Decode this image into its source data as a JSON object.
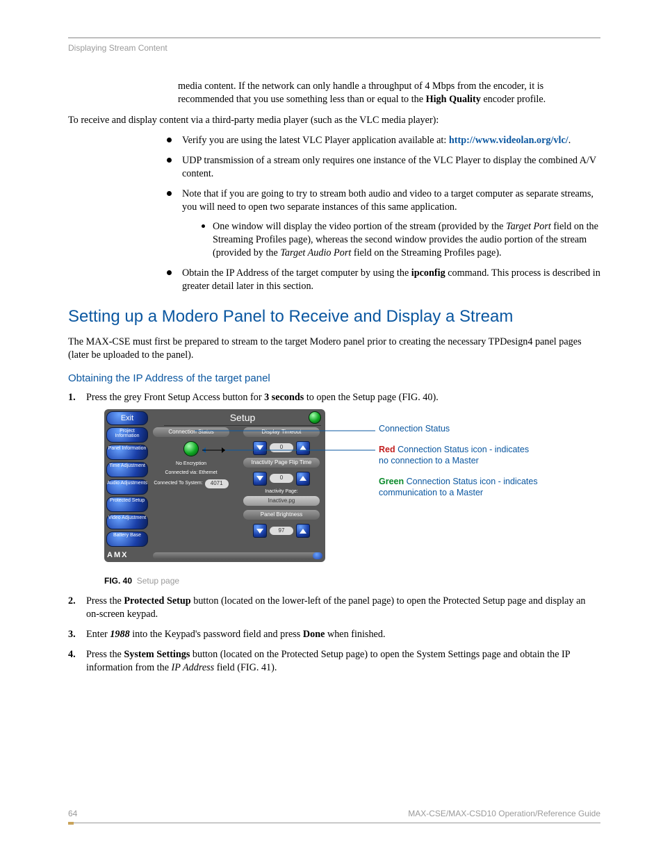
{
  "running_head": "Displaying Stream Content",
  "intro_para": {
    "pre": "media content. If the network can only handle a throughput of 4 Mbps from the encoder, it is recommended that you use something less than or equal to the ",
    "bold": "High Quality",
    "post": " encoder profile."
  },
  "lead_para": "To receive and display content via a third-party media player (such as the VLC media player):",
  "bullets": [
    {
      "pre": "Verify you are using the latest VLC Player application available at: ",
      "link": "http://www.videolan.org/vlc/",
      "post": "."
    },
    {
      "text": "UDP transmission of a stream only requires one instance of the VLC Player to display the combined A/V content."
    },
    {
      "text": "Note that if you are going to try to stream both audio and video to a target computer as separate streams, you will need to open two separate instances of this same application.",
      "sub": {
        "pre": "One window will display the video portion of the stream (provided by the ",
        "i1": "Target Port",
        "mid": " field on the Streaming Profiles page), whereas the second window provides the audio portion of the stream (provided by the ",
        "i2": "Target Audio Port",
        "post": " field on the Streaming Profiles page)."
      }
    },
    {
      "pre4": "Obtain the IP Address of the target computer by using the ",
      "b4": "ipconfig",
      "post4": " command. This process is described in greater detail later in this section."
    }
  ],
  "h1": "Setting up a Modero Panel to Receive and Display a Stream",
  "h1_para": "The MAX-CSE must first be prepared to stream to the target Modero panel prior to creating the necessary TPDesign4 panel pages (later be uploaded to the panel).",
  "h2": "Obtaining the IP Address of the target panel",
  "steps": {
    "s1": {
      "pre": "Press the grey Front Setup Access button for ",
      "b": "3 seconds",
      "post": " to open the Setup page (FIG. 40)."
    },
    "s2": {
      "pre": "Press the ",
      "b": "Protected Setup",
      "post": " button (located on the lower-left of the panel page) to open the Protected Setup page and display an on-screen keypad."
    },
    "s3": {
      "pre": "Enter ",
      "bi": "1988",
      "mid": " into the Keypad's password field and press ",
      "b2": "Done",
      "post": " when finished."
    },
    "s4": {
      "pre": "Press the ",
      "b": "System Settings",
      "mid": " button (located on the Protected Setup page) to open the System Settings page and obtain the IP information from the ",
      "i": "IP Address",
      "post": " field (FIG. 41)."
    }
  },
  "fig": {
    "label": "FIG. 40",
    "caption": "Setup page"
  },
  "setup": {
    "title": "Setup",
    "exit": "Exit",
    "side": [
      "Project\nInformation",
      "Panel\nInformation",
      "Time\nAdjustment",
      "Audio\nAdjustments",
      "Protected\nSetup",
      "Video\nAdjustment",
      "Battery\nBase"
    ],
    "col1_hdr": "Connection Status",
    "noenc": "No Encryption",
    "conn_via": "Connected via: Ethernet",
    "conn_sys": "Connected To System:",
    "sys_val": "4071",
    "col2_hdr1": "Display Timeout",
    "dt_val": "0",
    "col2_hdr2": "Inactivity Page Flip Time",
    "ip_val": "0",
    "ip_label": "Inactivity Page:",
    "ip_pg": "Inactive.pg",
    "col2_hdr3": "Panel Brightness",
    "pb_val": "97",
    "logo": "AMX"
  },
  "callouts": {
    "c1": "Connection Status",
    "c2a": "Red",
    "c2b": " Connection Status icon - indicates no connection to a Master",
    "c3a": "Green",
    "c3b": " Connection Status icon - indicates communication to a Master"
  },
  "footer": {
    "page": "64",
    "guide": "MAX-CSE/MAX-CSD10 Operation/Reference Guide"
  }
}
